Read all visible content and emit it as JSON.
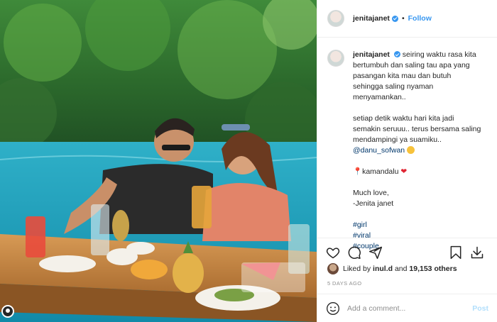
{
  "post": {
    "username": "jenitajanet",
    "verified": true,
    "follow_label": "Follow",
    "separator": "•"
  },
  "caption": {
    "username": "jenitajanet",
    "lines": [
      "seiring waktu rasa kita",
      "bertumbuh dan saling tau apa yang",
      "pasangan kita mau dan butuh",
      "sehingga saling nyaman",
      "menyamankan..",
      "",
      "setiap detik waktu hari kita jadi",
      "semakin seruuu.. terus bersama saling",
      "mendampingi ya suamiku..",
      "",
      "",
      "kamandalu",
      "",
      "Much love,",
      "-Jenita janet",
      "",
      "#girl",
      "#viral",
      "#couple"
    ],
    "mention": "@danu_sofwan",
    "hashtags": [
      "#girl",
      "#viral",
      "#couple"
    ]
  },
  "likes": {
    "prefix": "Liked by",
    "user": "inul.d",
    "and": "and",
    "count": "19,153 others"
  },
  "time_ago": "5 DAYS AGO",
  "comment": {
    "placeholder": "Add a comment...",
    "post_label": "Post"
  },
  "icons": {
    "like": "heart-icon",
    "comment": "comment-icon",
    "share": "paper-plane-icon",
    "save": "bookmark-icon",
    "download": "download-icon",
    "emoji": "smiley-icon"
  },
  "colors": {
    "accent": "#3897f0",
    "post_disabled": "#b2dffc",
    "link": "#00376b"
  }
}
